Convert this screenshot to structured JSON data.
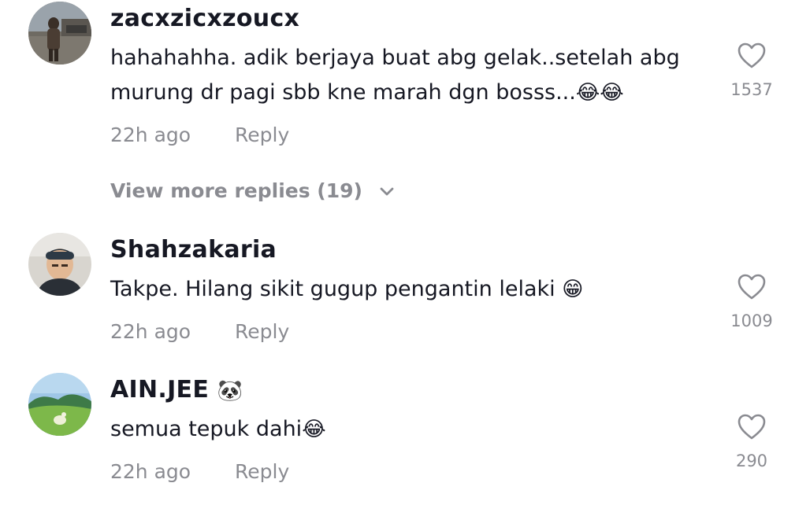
{
  "comments": [
    {
      "username": "zacxzicxzoucx",
      "text": "hahahahha. adik berjaya buat abg gelak..setelah abg murung dr pagi sbb kne marah dgn bosss...",
      "emoji": "😂😂",
      "time": "22h ago",
      "reply_label": "Reply",
      "likes": "1537",
      "avatar": "photo-street-icon"
    },
    {
      "username": "Shahzakaria",
      "text": "Takpe. Hilang sikit gugup pengantin lelaki ",
      "emoji": "😁",
      "time": "22h ago",
      "reply_label": "Reply",
      "likes": "1009",
      "avatar": "photo-person-icon"
    },
    {
      "username": "AIN.JEE ",
      "username_emoji": "🐼",
      "text": "semua tepuk dahi",
      "emoji": "😂",
      "time": "22h ago",
      "reply_label": "Reply",
      "likes": "290",
      "avatar": "photo-landscape-icon"
    }
  ],
  "view_more": {
    "label": "View more replies (19)",
    "icon": "chevron-down-icon"
  },
  "colors": {
    "primary_text": "#161823",
    "secondary_text": "#8a8b91",
    "background": "#ffffff"
  }
}
